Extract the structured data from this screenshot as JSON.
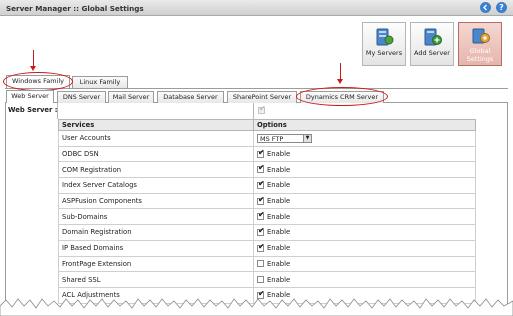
{
  "window": {
    "title": "Server Manager :: Global Settings",
    "back_icon": "back-icon",
    "help_icon": "help-icon",
    "help_glyph": "?"
  },
  "toolbar": {
    "buttons": [
      {
        "label": "My Servers",
        "icon": "servers-icon",
        "selected": false
      },
      {
        "label": "Add Server",
        "icon": "add-server-icon",
        "selected": false
      },
      {
        "label_line1": "Global",
        "label_line2": "Settings",
        "icon": "global-settings-icon",
        "selected": true
      }
    ]
  },
  "family_tabs": {
    "items": [
      "Windows Family",
      "Linux Family"
    ],
    "active": "Windows Family"
  },
  "server_tabs": {
    "items": [
      "Web Server",
      "DNS Server",
      "Mail Server",
      "Database Server",
      "SharePoint Server",
      "Dynamics CRM Server"
    ],
    "active": "Web Server"
  },
  "web_server": {
    "label": "Web Server :",
    "enabled": true
  },
  "services_table": {
    "headers": [
      "Services",
      "Options"
    ],
    "rows": [
      {
        "service": "User Accounts",
        "type": "select",
        "value": "MS FTP"
      },
      {
        "service": "ODBC DSN",
        "type": "checkbox",
        "checked": true,
        "option_label": "Enable"
      },
      {
        "service": "COM Registration",
        "type": "checkbox",
        "checked": true,
        "option_label": "Enable"
      },
      {
        "service": "Index Server Catalogs",
        "type": "checkbox",
        "checked": true,
        "option_label": "Enable"
      },
      {
        "service": "ASPFusion Components",
        "type": "checkbox",
        "checked": true,
        "option_label": "Enable"
      },
      {
        "service": "Sub-Domains",
        "type": "checkbox",
        "checked": true,
        "option_label": "Enable"
      },
      {
        "service": "Domain Registration",
        "type": "checkbox",
        "checked": true,
        "option_label": "Enable"
      },
      {
        "service": "IP Based Domains",
        "type": "checkbox",
        "checked": true,
        "option_label": "Enable"
      },
      {
        "service": "FrontPage Extension",
        "type": "checkbox",
        "checked": false,
        "option_label": "Enable"
      },
      {
        "service": "Shared SSL",
        "type": "checkbox",
        "checked": false,
        "option_label": "Enable"
      },
      {
        "service": "ACL Adjustments",
        "type": "checkbox",
        "checked": true,
        "option_label": "Enable"
      }
    ]
  },
  "colors": {
    "annotation_red": "#cc1a1a",
    "selected_button": "#e6b5ad",
    "header_bg": "#e9e9e9"
  }
}
